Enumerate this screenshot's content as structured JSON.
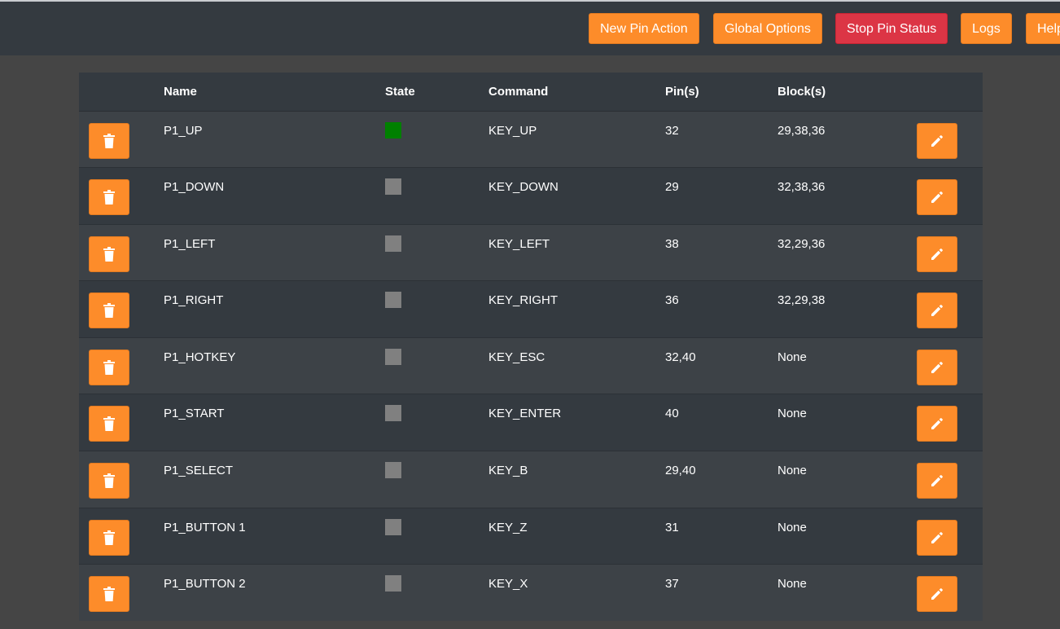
{
  "toolbar": {
    "new_pin_action": "New Pin Action",
    "global_options": "Global Options",
    "stop_pin_status": "Stop Pin Status",
    "logs": "Logs",
    "help": "Help"
  },
  "colors": {
    "accent": "#fd8c2a",
    "danger": "#dc3545",
    "state_active": "#008000",
    "state_inactive": "#808080"
  },
  "table": {
    "headers": {
      "name": "Name",
      "state": "State",
      "command": "Command",
      "pins": "Pin(s)",
      "blocks": "Block(s)"
    },
    "rows": [
      {
        "name": "P1_UP",
        "state": "active",
        "command": "KEY_UP",
        "pins": "32",
        "blocks": "29,38,36"
      },
      {
        "name": "P1_DOWN",
        "state": "inactive",
        "command": "KEY_DOWN",
        "pins": "29",
        "blocks": "32,38,36"
      },
      {
        "name": "P1_LEFT",
        "state": "inactive",
        "command": "KEY_LEFT",
        "pins": "38",
        "blocks": "32,29,36"
      },
      {
        "name": "P1_RIGHT",
        "state": "inactive",
        "command": "KEY_RIGHT",
        "pins": "36",
        "blocks": "32,29,38"
      },
      {
        "name": "P1_HOTKEY",
        "state": "inactive",
        "command": "KEY_ESC",
        "pins": "32,40",
        "blocks": "None"
      },
      {
        "name": "P1_START",
        "state": "inactive",
        "command": "KEY_ENTER",
        "pins": "40",
        "blocks": "None"
      },
      {
        "name": "P1_SELECT",
        "state": "inactive",
        "command": "KEY_B",
        "pins": "29,40",
        "blocks": "None"
      },
      {
        "name": "P1_BUTTON 1",
        "state": "inactive",
        "command": "KEY_Z",
        "pins": "31",
        "blocks": "None"
      },
      {
        "name": "P1_BUTTON 2",
        "state": "inactive",
        "command": "KEY_X",
        "pins": "37",
        "blocks": "None"
      }
    ]
  }
}
